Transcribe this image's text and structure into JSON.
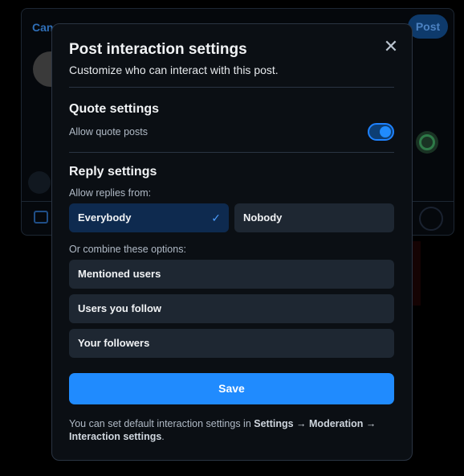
{
  "background": {
    "cancel_label": "Can",
    "post_label": "Post"
  },
  "modal": {
    "title": "Post interaction settings",
    "subtitle": "Customize who can interact with this post.",
    "close_icon": "close-icon",
    "quote": {
      "title": "Quote settings",
      "allow_label": "Allow quote posts",
      "enabled": true
    },
    "reply": {
      "title": "Reply settings",
      "allow_from_label": "Allow replies from:",
      "options": [
        "Everybody",
        "Nobody"
      ],
      "selected": "Everybody",
      "combine_label": "Or combine these options:",
      "combine_options": [
        "Mentioned users",
        "Users you follow",
        "Your followers"
      ]
    },
    "save_label": "Save",
    "footer": {
      "prefix": "You can set default interaction settings in ",
      "path_1": "Settings",
      "arrow": " → ",
      "path_2": "Moderation",
      "path_3": "Interaction settings",
      "suffix": "."
    }
  },
  "colors": {
    "accent": "#208bfe",
    "modal_bg": "#0b0f14",
    "option_bg": "#1e2732",
    "selected_bg": "#0e2a4f"
  }
}
